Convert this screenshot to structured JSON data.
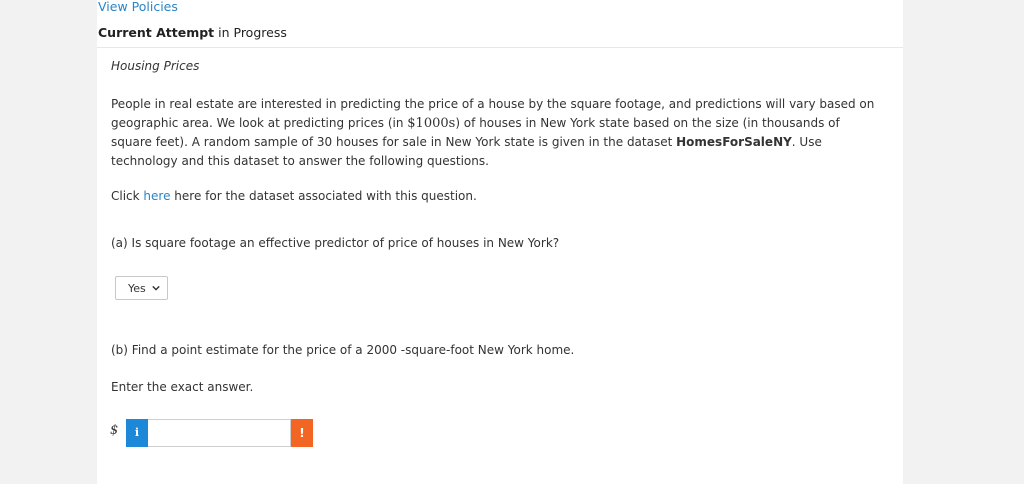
{
  "header": {
    "view_policies": "View Policies",
    "attempt_bold": "Current Attempt",
    "attempt_rest": " in Progress"
  },
  "question": {
    "title": "Housing Prices",
    "intro_part1": "People in real estate are interested in predicting the price of a house by the square footage, and predictions will vary based on geographic area. We look at predicting prices (in ",
    "intro_money": "$1000s",
    "intro_part2": ") of houses in New York state based on the size (in thousands of square feet). A random sample of 30 houses for sale in New York state is given in the dataset ",
    "intro_dataset": "HomesForSaleNY",
    "intro_part3": ". Use technology and this dataset to answer the following questions.",
    "click_prefix": "Click ",
    "click_link": "here",
    "click_suffix": " here for the dataset associated with this question.",
    "part_a": "(a) Is square footage an effective predictor of price of houses in New York?",
    "part_a_selected": "Yes",
    "part_b": "(b) Find a point estimate for the price of a 2000 -square-foot New York home.",
    "enter_exact": "Enter the exact answer.",
    "currency_symbol": "$",
    "info_label": "i",
    "answer_value": "",
    "warn_label": "!"
  },
  "colors": {
    "link": "#2a84c7",
    "info_button": "#1e88d8",
    "warning_button": "#f26522",
    "background": "#f2f2f2"
  },
  "icons": {
    "select_arrow": "chevron-down-icon",
    "info": "info-icon",
    "warning": "exclamation-icon"
  }
}
